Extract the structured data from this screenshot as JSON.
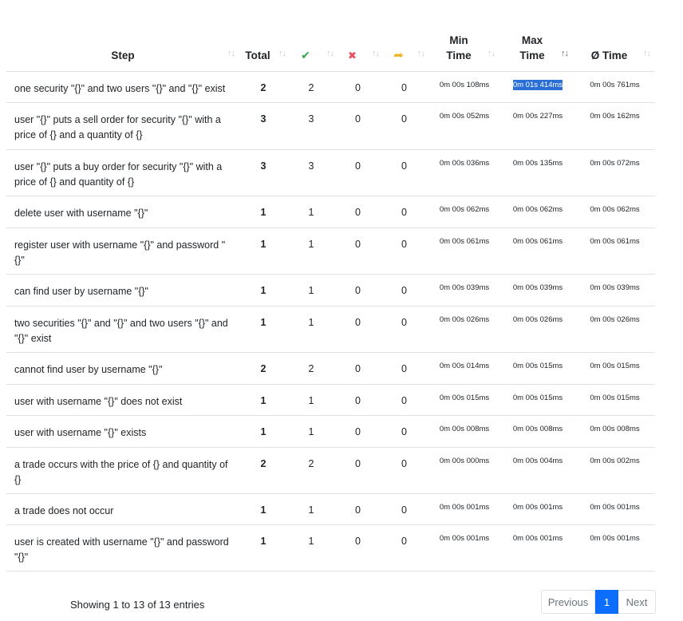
{
  "headers": {
    "step": "Step",
    "total": "Total",
    "pass_icon": "check-icon",
    "fail_icon": "cross-icon",
    "skip_icon": "skip-arrow-icon",
    "min_time_1": "Min",
    "min_time_2": "Time",
    "max_time_1": "Max",
    "max_time_2": "Time",
    "avg_time": "Ø Time",
    "sort_glyph": "↑↓"
  },
  "rows": [
    {
      "step": "one security \"{}\" and two users \"{}\" and \"{}\" exist",
      "total": "2",
      "passed": "2",
      "failed": "0",
      "skipped": "0",
      "min": "0m 00s 108ms",
      "max": "0m 01s 414ms",
      "avg": "0m 00s 761ms"
    },
    {
      "step": "user \"{}\" puts a sell order for security \"{}\" with a price of {} and a quantity of {}",
      "total": "3",
      "passed": "3",
      "failed": "0",
      "skipped": "0",
      "min": "0m 00s 052ms",
      "max": "0m 00s 227ms",
      "avg": "0m 00s 162ms"
    },
    {
      "step": "user \"{}\" puts a buy order for security \"{}\" with a price of {} and quantity of {}",
      "total": "3",
      "passed": "3",
      "failed": "0",
      "skipped": "0",
      "min": "0m 00s 036ms",
      "max": "0m 00s 135ms",
      "avg": "0m 00s 072ms"
    },
    {
      "step": "delete user with username \"{}\"",
      "total": "1",
      "passed": "1",
      "failed": "0",
      "skipped": "0",
      "min": "0m 00s 062ms",
      "max": "0m 00s 062ms",
      "avg": "0m 00s 062ms"
    },
    {
      "step": "register user with username \"{}\" and password \"{}\"",
      "total": "1",
      "passed": "1",
      "failed": "0",
      "skipped": "0",
      "min": "0m 00s 061ms",
      "max": "0m 00s 061ms",
      "avg": "0m 00s 061ms"
    },
    {
      "step": "can find user by username \"{}\"",
      "total": "1",
      "passed": "1",
      "failed": "0",
      "skipped": "0",
      "min": "0m 00s 039ms",
      "max": "0m 00s 039ms",
      "avg": "0m 00s 039ms"
    },
    {
      "step": "two securities \"{}\" and \"{}\" and two users \"{}\" and \"{}\" exist",
      "total": "1",
      "passed": "1",
      "failed": "0",
      "skipped": "0",
      "min": "0m 00s 026ms",
      "max": "0m 00s 026ms",
      "avg": "0m 00s 026ms"
    },
    {
      "step": "cannot find user by username \"{}\"",
      "total": "2",
      "passed": "2",
      "failed": "0",
      "skipped": "0",
      "min": "0m 00s 014ms",
      "max": "0m 00s 015ms",
      "avg": "0m 00s 015ms"
    },
    {
      "step": "user with username \"{}\" does not exist",
      "total": "1",
      "passed": "1",
      "failed": "0",
      "skipped": "0",
      "min": "0m 00s 015ms",
      "max": "0m 00s 015ms",
      "avg": "0m 00s 015ms"
    },
    {
      "step": "user with username \"{}\" exists",
      "total": "1",
      "passed": "1",
      "failed": "0",
      "skipped": "0",
      "min": "0m 00s 008ms",
      "max": "0m 00s 008ms",
      "avg": "0m 00s 008ms"
    },
    {
      "step": "a trade occurs with the price of {} and quantity of {}",
      "total": "2",
      "passed": "2",
      "failed": "0",
      "skipped": "0",
      "min": "0m 00s 000ms",
      "max": "0m 00s 004ms",
      "avg": "0m 00s 002ms"
    },
    {
      "step": "a trade does not occur",
      "total": "1",
      "passed": "1",
      "failed": "0",
      "skipped": "0",
      "min": "0m 00s 001ms",
      "max": "0m 00s 001ms",
      "avg": "0m 00s 001ms"
    },
    {
      "step": "user is created with username \"{}\" and password \"{}\"",
      "total": "1",
      "passed": "1",
      "failed": "0",
      "skipped": "0",
      "min": "0m 00s 001ms",
      "max": "0m 00s 001ms",
      "avg": "0m 00s 001ms"
    }
  ],
  "footer": {
    "info": "Showing 1 to 13 of 13 entries",
    "previous": "Previous",
    "current_page": "1",
    "next": "Next"
  },
  "colors": {
    "pass": "#2ea84a",
    "fail": "#e84e63",
    "skip": "#f0b429",
    "accent": "#0d6efd"
  }
}
